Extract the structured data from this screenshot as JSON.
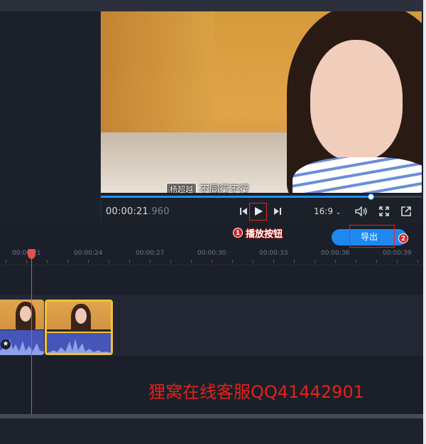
{
  "player": {
    "subtitle_name": "杨超越",
    "subtitle_text": "不同行不行",
    "timecode_main": "00:00:21",
    "timecode_ms": ".960",
    "progress": 0.84,
    "aspect_ratio": "16:9"
  },
  "annotations": {
    "play_badge": "1",
    "play_label": "播放按钮",
    "export_badge": "2"
  },
  "toolbar": {
    "export_label": "导出"
  },
  "ruler": {
    "ticks": [
      "00:00:21",
      "00:00:24",
      "00:00:27",
      "00:00:30",
      "00:00:33",
      "00:00:36",
      "00:00:39"
    ]
  },
  "watermark": "狸窝在线客服QQ41442901",
  "colors": {
    "accent": "#1e88f0",
    "playhead": "#e25050",
    "annotation_red": "#e52424",
    "clip_selected_border": "#f2c230",
    "audio_wave": "#4655b8"
  },
  "icons": [
    "skip-back-icon",
    "play-icon",
    "skip-forward-icon",
    "chevron-down-icon",
    "volume-icon",
    "fullscreen-icon",
    "popout-icon",
    "star-icon"
  ]
}
